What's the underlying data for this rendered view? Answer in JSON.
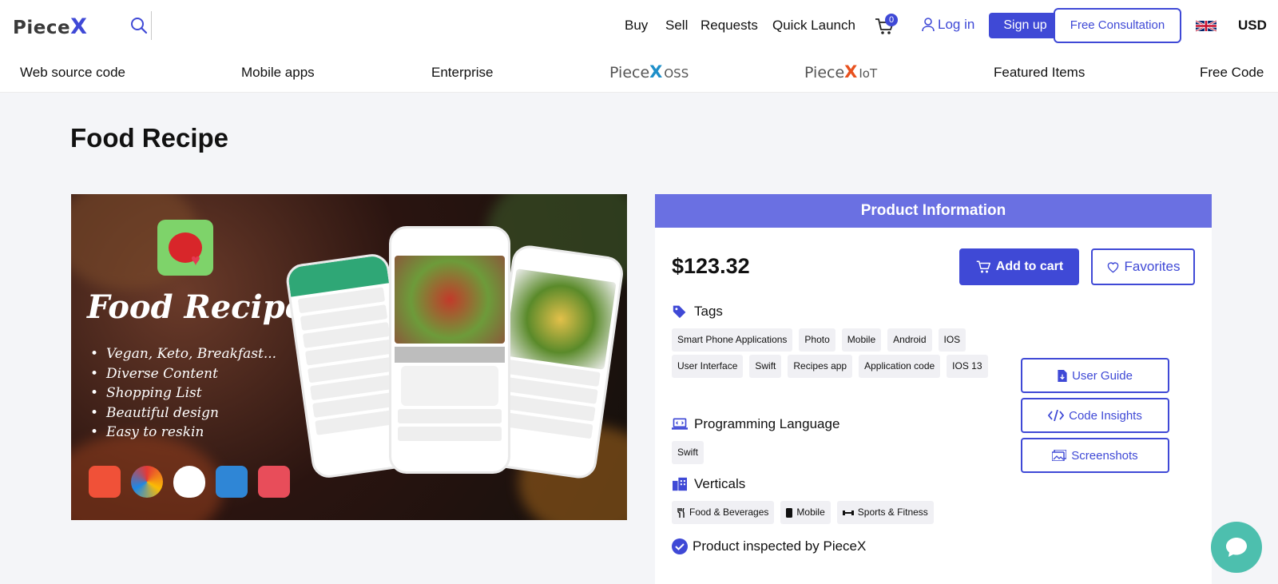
{
  "header": {
    "logo_main": "Piece",
    "logo_x": "X",
    "nav": [
      "Buy",
      "Sell",
      "Requests",
      "Quick Launch"
    ],
    "cart_count": "0",
    "login": "Log in",
    "signup": "Sign up",
    "consultation": "Free Consultation",
    "currency": "USD",
    "flag": "uk-flag-icon"
  },
  "categories": {
    "web": "Web source code",
    "mobile": "Mobile apps",
    "enterprise": "Enterprise",
    "oss_logo": "Piece",
    "oss_x": "X",
    "oss_suffix": "OSS",
    "iot_logo": "Piece",
    "iot_x": "X",
    "iot_suffix": "IoT",
    "featured": "Featured Items",
    "free": "Free Code"
  },
  "page": {
    "title": "Food Recipe"
  },
  "hero": {
    "title": "Food Recipes",
    "bullets": [
      "Vegan, Keto, Breakfast...",
      "Diverse Content",
      "Shopping List",
      "Beautiful design",
      "Easy to reskin"
    ]
  },
  "product": {
    "header": "Product Information",
    "price": "$123.32",
    "add_to_cart": "Add to cart",
    "favorites": "Favorites",
    "tags_title": "Tags",
    "tags": [
      "Smart Phone Applications",
      "Photo",
      "Mobile",
      "Android",
      "IOS",
      "User Interface",
      "Swift",
      "Recipes app",
      "Application code",
      "IOS 13"
    ],
    "lang_title": "Programming Language",
    "languages": [
      "Swift"
    ],
    "verticals_title": "Verticals",
    "verticals": [
      "Food & Beverages",
      "Mobile",
      "Sports & Fitness"
    ],
    "user_guide": "User Guide",
    "code_insights": "Code Insights",
    "screenshots": "Screenshots",
    "inspected": "Product inspected by PieceX"
  },
  "colors": {
    "accent": "#3f49d6",
    "info_header": "#6a70e2",
    "chat": "#4dbfae"
  }
}
